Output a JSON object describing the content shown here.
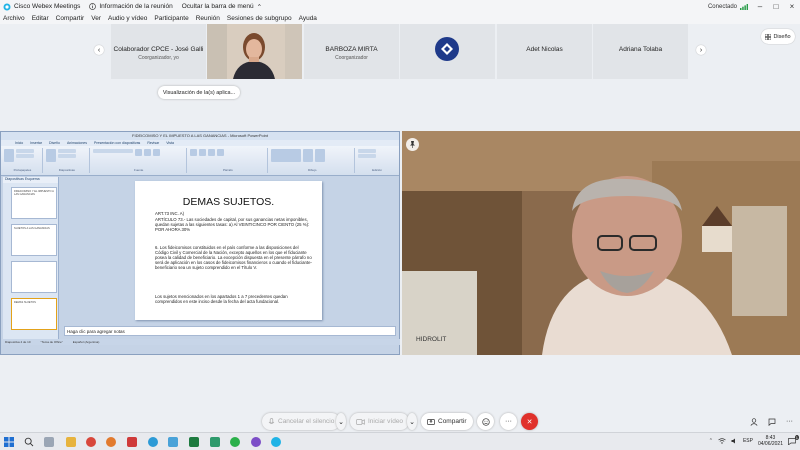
{
  "app": {
    "title": "Cisco Webex Meetings",
    "tab_info": "Información de la reunión",
    "hide_menu": "Ocultar la barra de menú",
    "status": "Conectado"
  },
  "menu": [
    "Archivo",
    "Editar",
    "Compartir",
    "Ver",
    "Audio y vídeo",
    "Participante",
    "Reunión",
    "Sesiones de subgrupo",
    "Ayuda"
  ],
  "participants": [
    {
      "name": "Colaborador CPCE - José Galli",
      "role": "Coorganizador, yo"
    },
    {
      "name": "",
      "role": ""
    },
    {
      "name": "BARBOZA MIRTA",
      "role": "Coorganizador"
    },
    {
      "name": "",
      "role": ""
    },
    {
      "name": "Adet Nicolas",
      "role": ""
    },
    {
      "name": "Adriana Tolaba",
      "role": ""
    }
  ],
  "layout_button": "Diseño",
  "share_pill": "Visualización de la(s) aplica...",
  "ppt": {
    "window_title": "FIDEICOMISO Y EL IMPUESTO A LAS GANANCIAS - Microsoft PowerPoint",
    "ribbon_tabs": [
      "Inicio",
      "Insertar",
      "Diseño",
      "Animaciones",
      "Presentación con diapositivas",
      "Revisar",
      "Vista"
    ],
    "ribbon_groups": [
      "Portapapeles",
      "Diapositivas",
      "Fuente",
      "Párrafo",
      "Dibujo",
      "Edición"
    ],
    "panel_tabs": "Diapositivas   Esquema",
    "thumbs": [
      "FIDEICOMISO Y EL IMPUESTO A LAS GANANCIAS",
      "SUJETOS A LAS GANANCIAS",
      "",
      "DEMAS SUJETOS"
    ],
    "slide": {
      "title": "DEMAS SUJETOS.",
      "bullet1": "ART.73 INC. A)",
      "bullet2": "ARTÍCULO 73.- Las sociedades de capital, por sus ganancias netas imponibles, quedan sujetas a las siguientes tasas: a) Al VEINTICINCO POR CIENTO (25 %): POR AHORA 30%",
      "para1": "6. Los fideicomisos constituidos en el país conforme a las disposiciones del Código Civil y Comercial de la Nación, excepto aquellos en los que el fiduciante posea la calidad de beneficiario. La excepción dispuesta en el presente párrafo no será de aplicación en los casos de fideicomisos financieros o cuando el fiduciante-beneficiario sea un sujeto comprendido en el Título V.",
      "para2": "Los sujetos mencionados en los apartados 1 a 7 precedentes quedan comprendidos en este inciso desde la fecha del acta fundacional."
    },
    "notes": "Haga clic para agregar notas",
    "status_slide": "Diapositiva 4 de 10",
    "status_theme": "\"Tema de Office\"",
    "status_lang": "Español (Argentina)"
  },
  "controls": {
    "mute": "Cancelar el silencio",
    "video": "Iniciar vídeo",
    "share": "Compartir"
  },
  "taskbar": {
    "lang": "ESP",
    "time": "8:43",
    "date": "04/06/2021",
    "notif_count": "1"
  },
  "colors": {
    "end_button": "#e0312b",
    "slide_panel": "#c5d3e6"
  }
}
